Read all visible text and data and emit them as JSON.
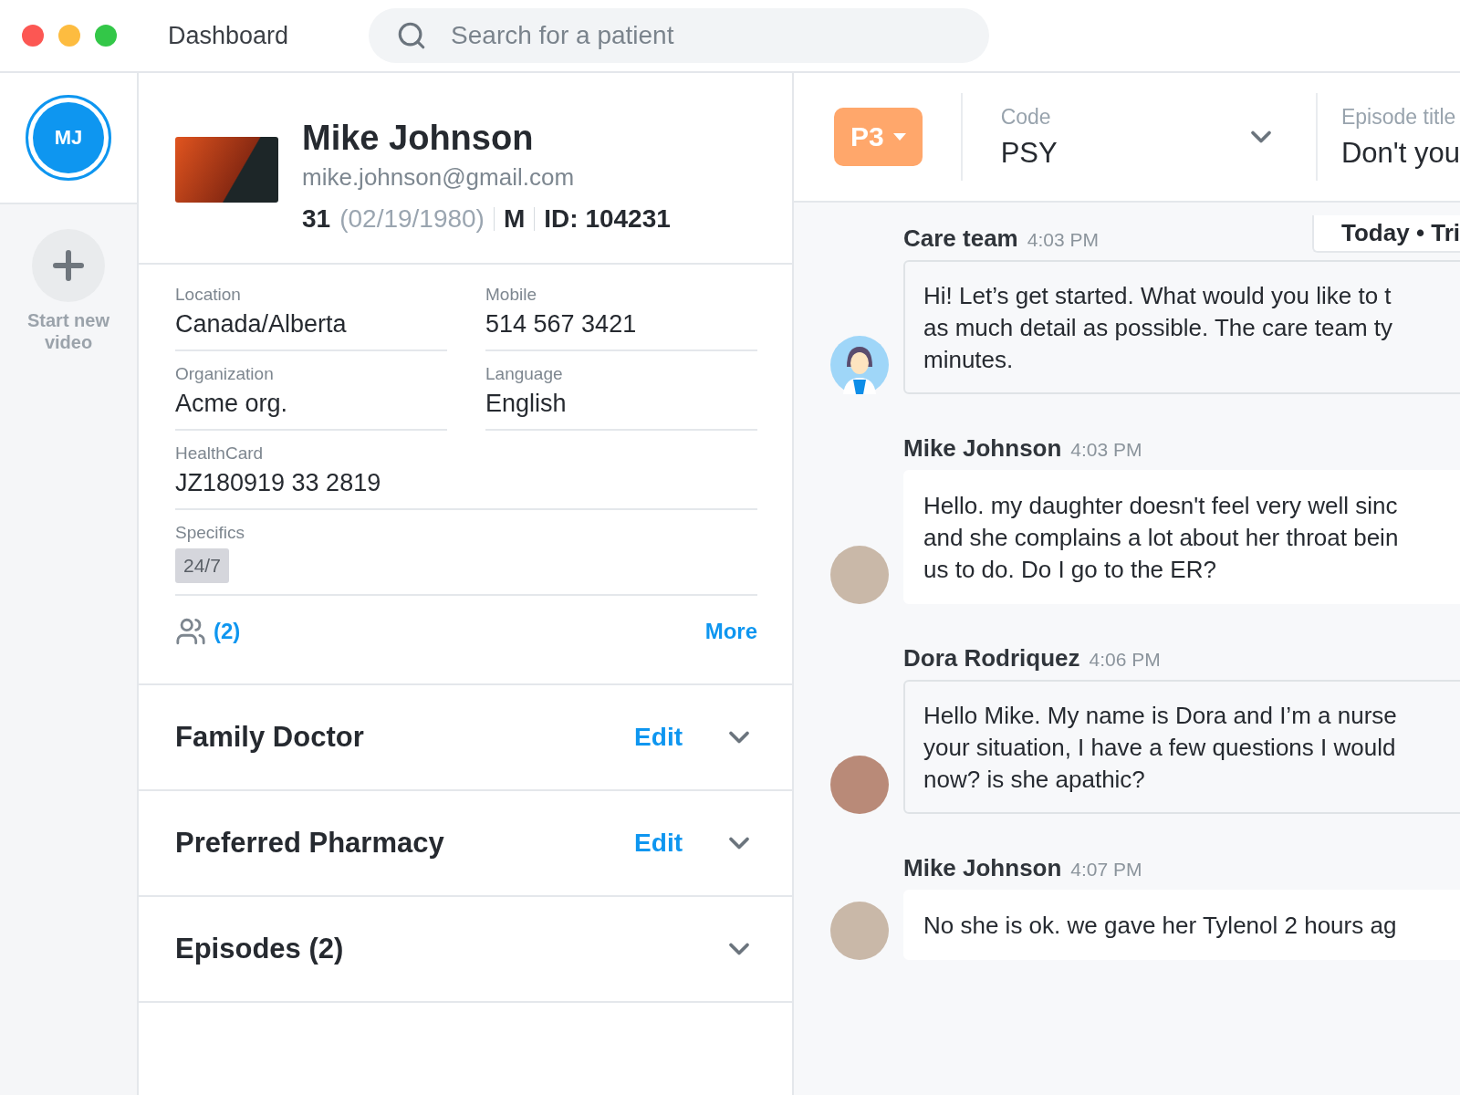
{
  "header": {
    "title": "Dashboard",
    "search": {
      "placeholder": "Search for a patient"
    }
  },
  "rail": {
    "avatar_initials": "MJ",
    "action_label": "Start new video"
  },
  "patient": {
    "name": "Mike Johnson",
    "email": "mike.johnson@gmail.com",
    "age": "31",
    "dob": "(02/19/1980)",
    "sex": "M",
    "id": "ID: 104231",
    "fields": [
      {
        "label": "Location",
        "value": "Canada/Alberta"
      },
      {
        "label": "Mobile",
        "value": "514 567 3421"
      },
      {
        "label": "Organization",
        "value": "Acme org."
      },
      {
        "label": "Language",
        "value": "English"
      },
      {
        "label": "HealthCard",
        "value": "JZ180919 33 2819"
      }
    ],
    "specifics": {
      "label": "Specifics",
      "tags": [
        "24/7"
      ]
    },
    "family_count": "(2)",
    "more": "More",
    "sections": [
      {
        "title": "Family Doctor",
        "action": "Edit",
        "expanded": false
      },
      {
        "title": "Preferred Pharmacy",
        "action": "Edit",
        "expanded": false
      },
      {
        "title": "Episodes (2)",
        "expanded": false
      }
    ]
  },
  "chat_header": {
    "priority": "P3",
    "code": {
      "label": "Code",
      "value": "PSY"
    },
    "episode": {
      "label": "Episode title",
      "value": "Don't you"
    }
  },
  "chat": {
    "date_tag": "Today • Tri",
    "messages": [
      {
        "kind": "bot",
        "sender": "Care team",
        "time": "4:03 PM",
        "lines": [
          "Hi! Let’s get started. What would you like to t",
          "as much detail as possible. The care team ty",
          "minutes."
        ]
      },
      {
        "kind": "patient",
        "sender": "Mike Johnson",
        "time": "4:03 PM",
        "lines": [
          "Hello. my daughter doesn't feel very well sinc",
          "and she complains a lot about her throat bein",
          "us to do. Do I go to the ER?"
        ]
      },
      {
        "kind": "staff",
        "sender": "Dora Rodriquez",
        "time": "4:06 PM",
        "lines": [
          "Hello Mike. My name is Dora and I’m a nurse",
          "your situation, I have a few questions I would",
          "now? is she apathic?"
        ]
      },
      {
        "kind": "patient",
        "sender": "Mike Johnson",
        "time": "4:07 PM",
        "lines": [
          "No she is ok. we gave her Tylenol 2 hours ag"
        ]
      }
    ]
  }
}
